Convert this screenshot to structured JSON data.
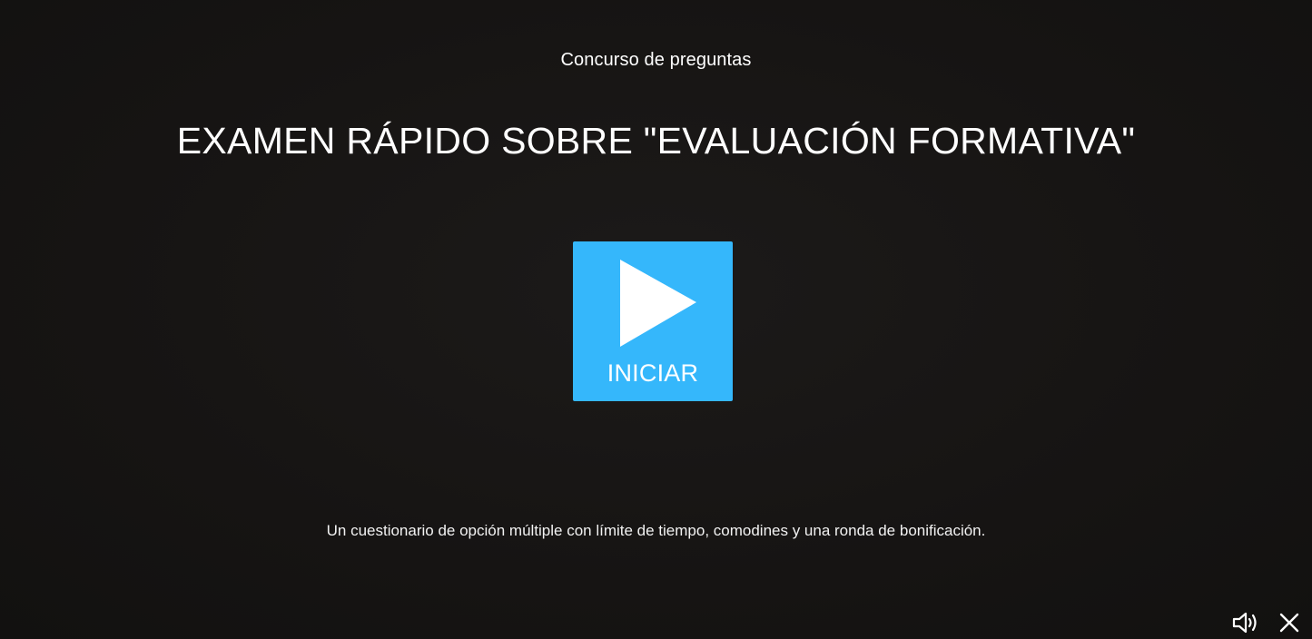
{
  "header": {
    "subtitle": "Concurso de preguntas",
    "title": "EXAMEN RÁPIDO SOBRE \"EVALUACIÓN FORMATIVA\""
  },
  "start": {
    "label": "INICIAR",
    "icon": "play-icon",
    "color": "#35b7fb"
  },
  "description": "Un cuestionario de opción múltiple con límite de tiempo, comodines y una ronda de bonificación.",
  "controls": {
    "sound_icon": "volume-icon",
    "close_icon": "close-icon"
  },
  "colors": {
    "background": "#161413",
    "text": "#ffffff",
    "accent": "#35b7fb"
  }
}
